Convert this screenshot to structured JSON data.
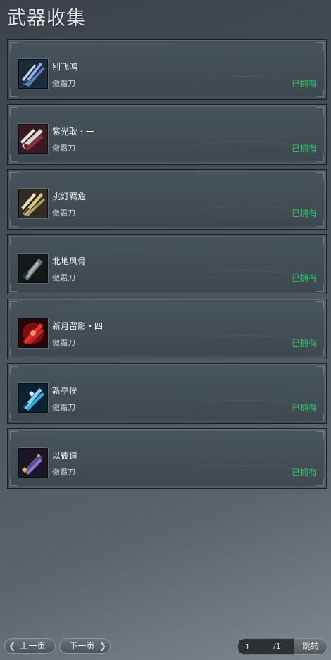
{
  "page_title": "武器收集",
  "items": [
    {
      "name": "别飞鸿",
      "category": "傲霜刀",
      "status": "已拥有",
      "icon": "blue-blades-icon",
      "tint": "#5f7fb8"
    },
    {
      "name": "紫光耿・一",
      "category": "傲霜刀",
      "status": "已拥有",
      "icon": "crimson-silver-blade-icon",
      "tint": "#8a2f3b"
    },
    {
      "name": "挑灯羁危",
      "category": "傲霜刀",
      "status": "已拥有",
      "icon": "golden-blades-icon",
      "tint": "#b39a62"
    },
    {
      "name": "北地风骨",
      "category": "傲霜刀",
      "status": "已拥有",
      "icon": "dark-grey-blade-icon",
      "tint": "#6c7378"
    },
    {
      "name": "新月留影・四",
      "category": "傲霜刀",
      "status": "已拥有",
      "icon": "red-flame-blade-icon",
      "tint": "#c0262a"
    },
    {
      "name": "新亭侯",
      "category": "傲霜刀",
      "status": "已拥有",
      "icon": "cyan-crystal-blade-icon",
      "tint": "#3aa7d6"
    },
    {
      "name": "以彼道",
      "category": "傲霜刀",
      "status": "已拥有",
      "icon": "purple-gold-blade-icon",
      "tint": "#5e4d93"
    }
  ],
  "pager": {
    "prev_label": "上一页",
    "next_label": "下一页",
    "current_page": "1",
    "total_pages": "/1",
    "jump_label": "跳转"
  },
  "colors": {
    "owned": "#35c26a",
    "background": "#4a535b"
  }
}
